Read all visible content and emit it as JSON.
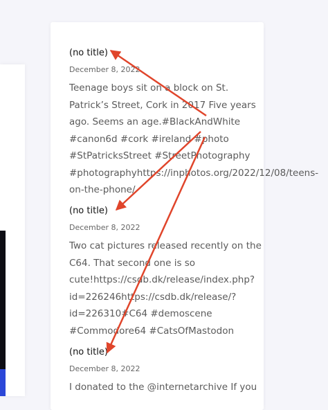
{
  "posts": [
    {
      "title": "(no title)",
      "date": "December 8, 2022",
      "lines": [
        "Teenage boys sit on a block on St.",
        "Patrick’s Street, Cork in 2017 Five years",
        "ago. Seems an age.#BlackAndWhite",
        "#canon6d #cork #ireland #photo",
        "#StPatricksStreet #StreetPhotography",
        "#photographyhttps://inphotos.org/2022/12/08/teens-",
        "on-the-phone/"
      ]
    },
    {
      "title": "(no title)",
      "date": "December 8, 2022",
      "lines": [
        "Two cat pictures released recently on the",
        "C64. That second one is so",
        "cute!https://csdb.dk/release/index.php?",
        "id=226246https://csdb.dk/release/?",
        "id=226310#C64 #demoscene",
        "#Commodore64 #CatsOfMastodon"
      ]
    },
    {
      "title": "(no title)",
      "date": "December 8, 2022",
      "lines": [
        "I donated to the @internetarchive If you"
      ]
    }
  ],
  "colors": {
    "annotation_arrow": "#e0452b"
  }
}
